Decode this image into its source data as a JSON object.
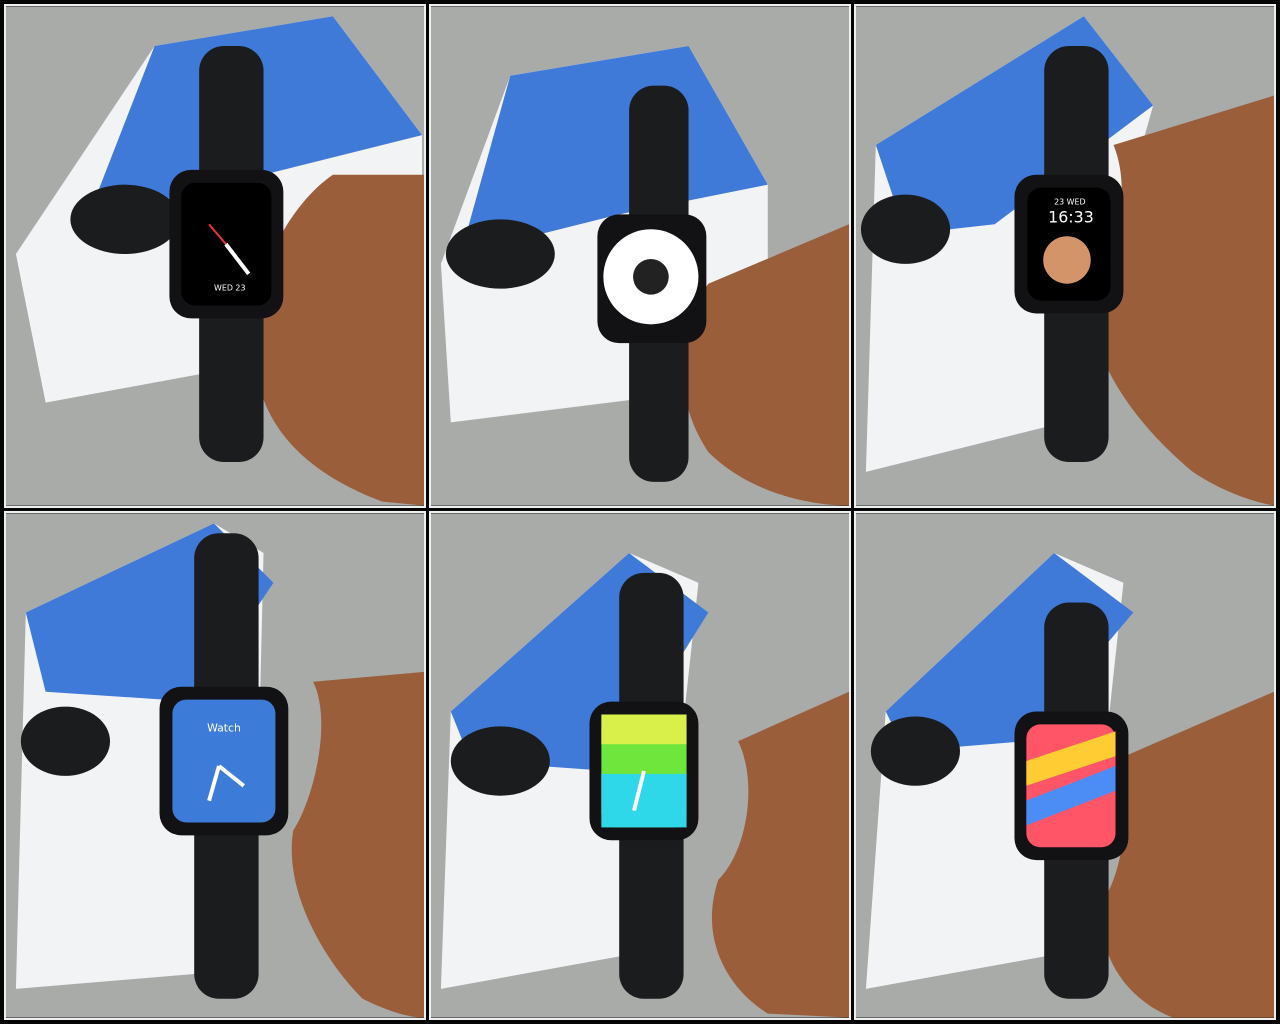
{
  "collage": {
    "panels": [
      {
        "face": "activity-numerals",
        "date_label": "WED 23"
      },
      {
        "face": "infograph-rings"
      },
      {
        "face": "memoji-digital",
        "date_label": "23 WED",
        "time_label": "16:33"
      },
      {
        "face": "blue-analog",
        "brand_label": "Watch"
      },
      {
        "face": "green-stripes-analog"
      },
      {
        "face": "rainbow-ribbons-analog"
      }
    ]
  },
  "colors": {
    "background_stone": "#a9aba9",
    "strap": "#1b1c1e",
    "skin": "#9a5f3a",
    "box_blue": "#3f7ad8",
    "box_white": "#f2f3f5",
    "border": "#eef0f0"
  }
}
